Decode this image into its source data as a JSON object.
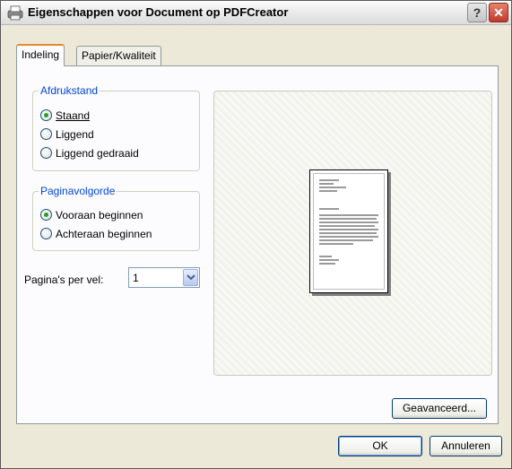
{
  "window": {
    "title": "Eigenschappen voor Document op PDFCreator",
    "help_label": "?",
    "close_label": "✕"
  },
  "tabs": [
    {
      "label": "Indeling",
      "active": true
    },
    {
      "label": "Papier/Kwaliteit",
      "active": false
    }
  ],
  "orientation": {
    "legend": "Afdrukstand",
    "options": [
      {
        "label": "Staand",
        "checked": true
      },
      {
        "label": "Liggend",
        "checked": false
      },
      {
        "label": "Liggend gedraaid",
        "checked": false
      }
    ]
  },
  "page_order": {
    "legend": "Paginavolgorde",
    "options": [
      {
        "label": "Vooraan beginnen",
        "checked": true
      },
      {
        "label": "Achteraan beginnen",
        "checked": false
      }
    ]
  },
  "pages_per_sheet": {
    "label": "Pagina's per vel:",
    "value": "1"
  },
  "buttons": {
    "advanced": "Geavanceerd...",
    "ok": "OK",
    "cancel": "Annuleren"
  },
  "colors": {
    "group_legend": "#0046d5",
    "radio_checked": "#21a121",
    "close_button": "#c0392b"
  }
}
